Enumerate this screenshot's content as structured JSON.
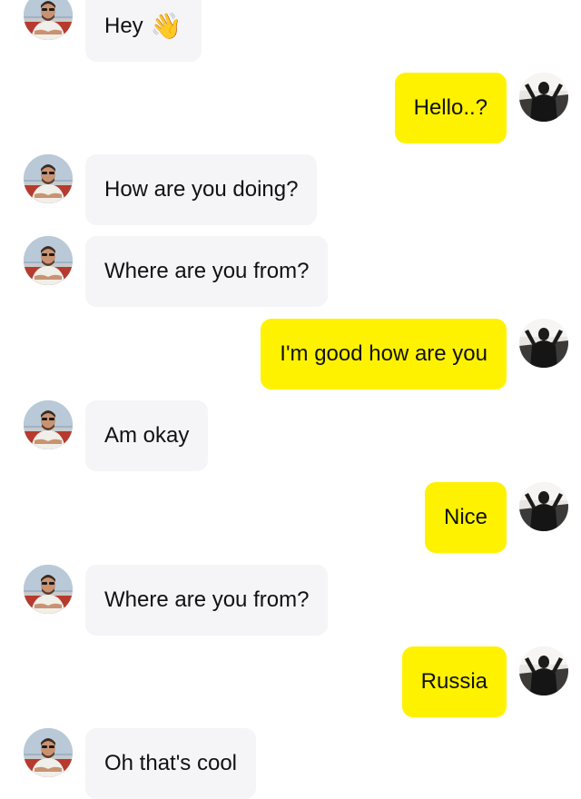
{
  "colors": {
    "incoming_bubble": "#f5f5f7",
    "outgoing_bubble": "#fff200",
    "text": "#111111"
  },
  "messages": [
    {
      "from": "them",
      "text": "Hey",
      "emoji": "👋"
    },
    {
      "from": "me",
      "text": "Hello..?"
    },
    {
      "from": "them",
      "text": "How are you doing?"
    },
    {
      "from": "them",
      "text": "Where are you from?"
    },
    {
      "from": "me",
      "text": "I'm good how are you"
    },
    {
      "from": "them",
      "text": "Am okay"
    },
    {
      "from": "me",
      "text": "Nice"
    },
    {
      "from": "them",
      "text": "Where are you from?"
    },
    {
      "from": "me",
      "text": "Russia"
    },
    {
      "from": "them",
      "text": "Oh that's cool"
    }
  ]
}
